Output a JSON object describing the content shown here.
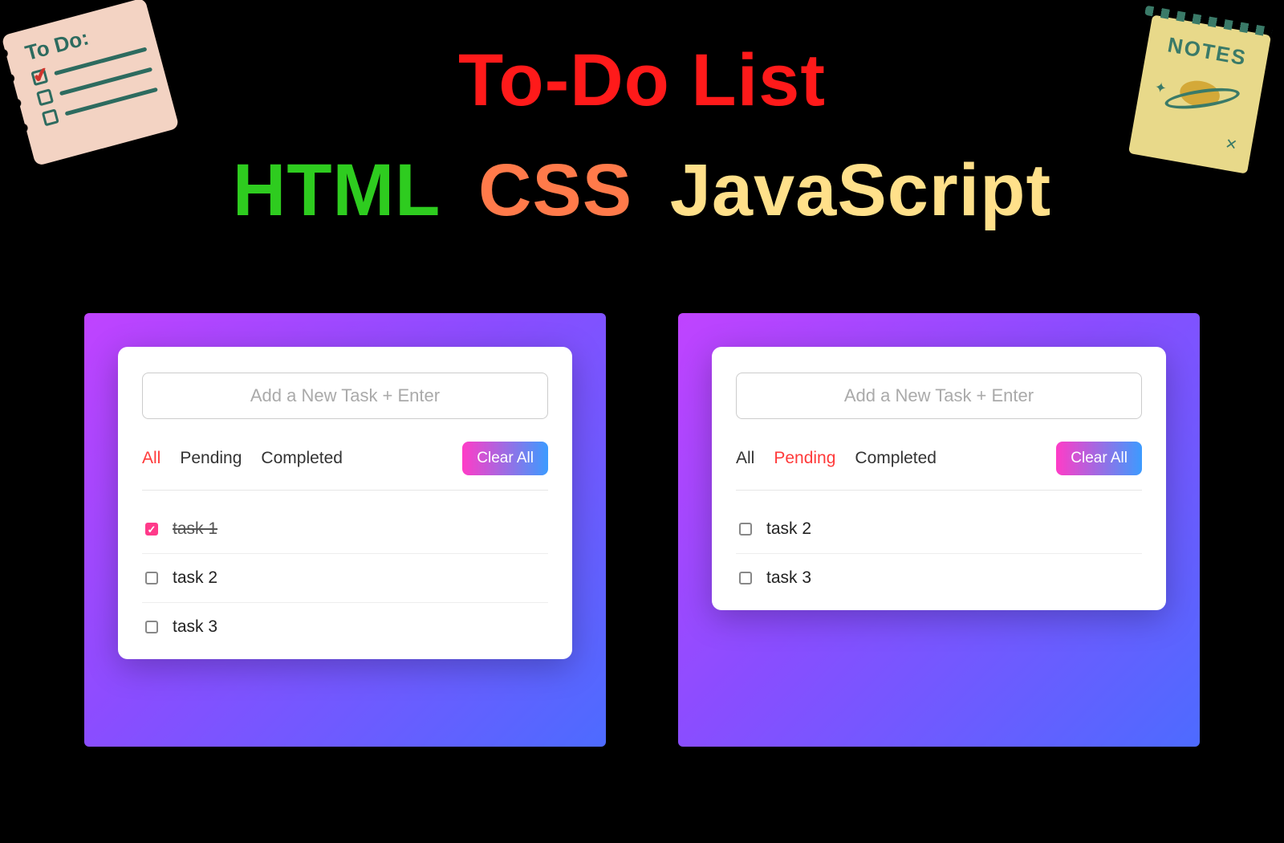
{
  "header": {
    "title": "To-Do List",
    "word_html": "HTML",
    "word_css": "CSS",
    "word_js": "JavaScript"
  },
  "stickers": {
    "todo_label": "To Do:",
    "notes_label": "NOTES"
  },
  "panel_left": {
    "input_placeholder": "Add a New Task + Enter",
    "filters": {
      "all": "All",
      "pending": "Pending",
      "completed": "Completed",
      "active": "all"
    },
    "clear_label": "Clear All",
    "tasks": [
      {
        "label": "task 1",
        "done": true
      },
      {
        "label": "task 2",
        "done": false
      },
      {
        "label": "task 3",
        "done": false
      }
    ]
  },
  "panel_right": {
    "input_placeholder": "Add a New Task + Enter",
    "filters": {
      "all": "All",
      "pending": "Pending",
      "completed": "Completed",
      "active": "pending"
    },
    "clear_label": "Clear All",
    "tasks": [
      {
        "label": "task 2",
        "done": false
      },
      {
        "label": "task 3",
        "done": false
      }
    ]
  }
}
